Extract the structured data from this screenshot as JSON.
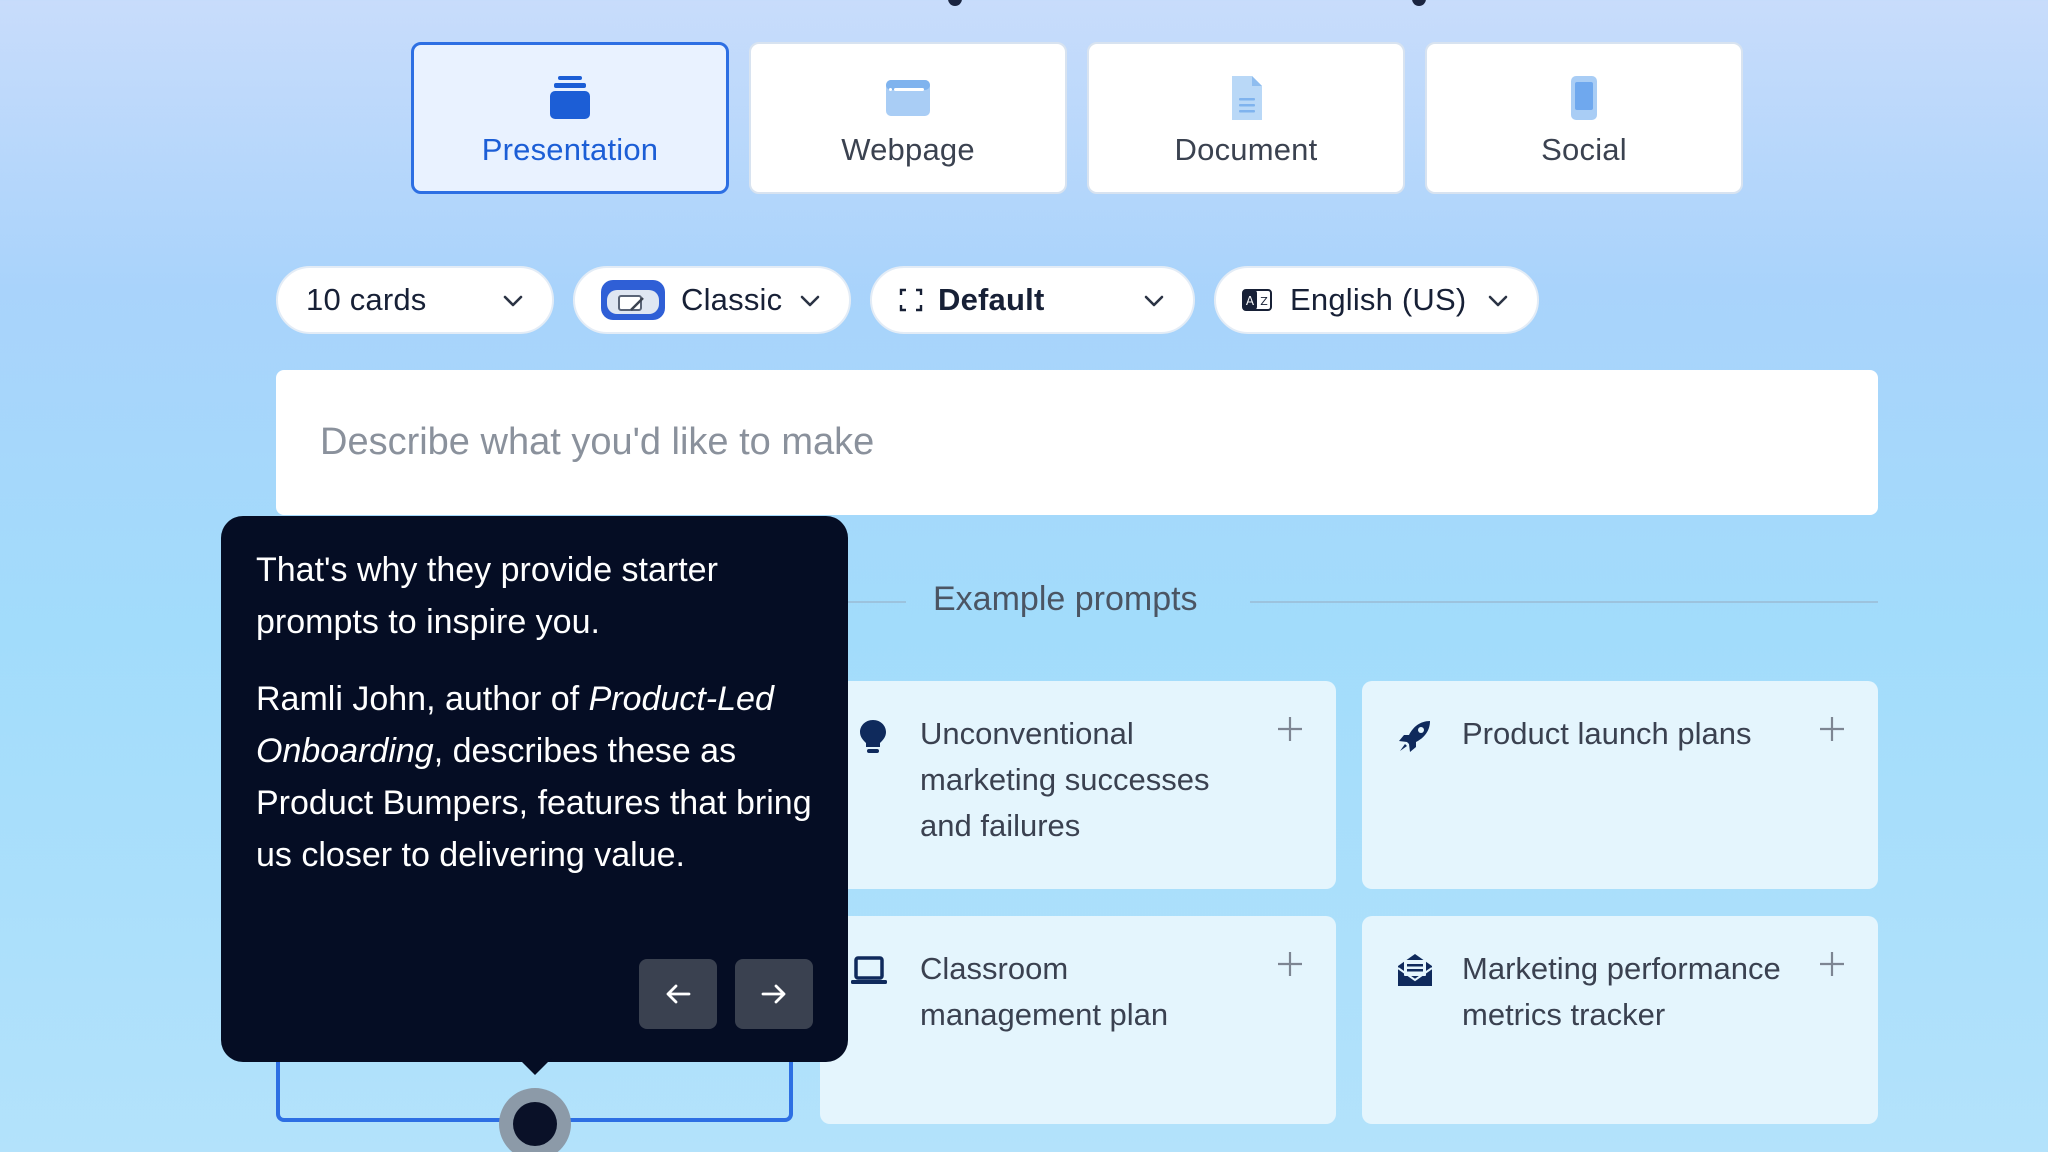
{
  "type_tabs": [
    {
      "label": "Presentation",
      "icon": "presentation-stack-icon",
      "active": true
    },
    {
      "label": "Webpage",
      "icon": "browser-window-icon",
      "active": false
    },
    {
      "label": "Document",
      "icon": "document-icon",
      "active": false
    },
    {
      "label": "Social",
      "icon": "phone-icon",
      "active": false
    }
  ],
  "options": {
    "cards": "10 cards",
    "theme": "Classic",
    "layout": "Default",
    "language": "English (US)"
  },
  "prompt": {
    "placeholder": "Describe what you'd like to make",
    "value": ""
  },
  "examples": {
    "title": "Example prompts",
    "cards": [
      {
        "text": "Unconventional marketing successes and failures",
        "icon": "lightbulb-icon"
      },
      {
        "text": "Product launch plans",
        "icon": "rocket-icon"
      },
      {
        "text": "Classroom management plan",
        "icon": "laptop-icon"
      },
      {
        "text": "Marketing performance metrics tracker",
        "icon": "mail-envelope-icon"
      }
    ]
  },
  "tooltip": {
    "para1": "That's why they provide starter prompts to inspire you.",
    "para2_prefix": "Ramli John, author of ",
    "para2_italic": "Product-Led Onboarding",
    "para2_suffix": ", describes these as Product Bumpers, features that bring us closer to delivering value."
  },
  "colors": {
    "accent": "#2d6fe3",
    "tooltip_bg": "#050d24",
    "card_bg": "#e4f5fd"
  }
}
